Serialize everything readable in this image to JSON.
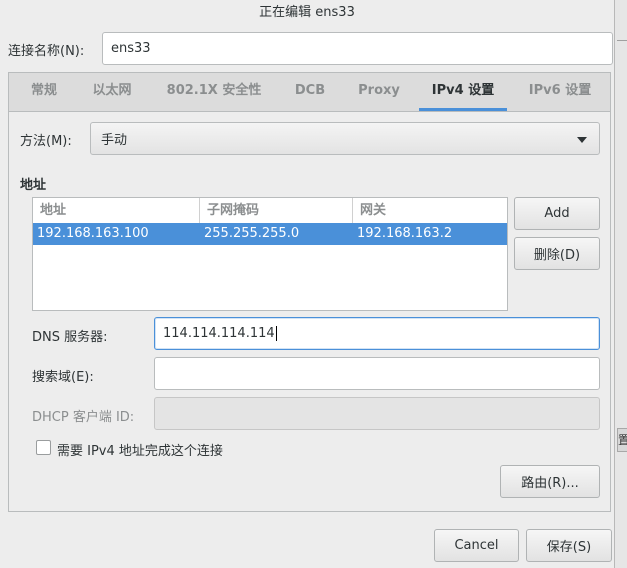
{
  "window": {
    "title": "正在编辑 ens33"
  },
  "connection": {
    "label": "连接名称(N):",
    "value": "ens33"
  },
  "tabs": [
    {
      "label": "常规",
      "active": false
    },
    {
      "label": "以太网",
      "active": false
    },
    {
      "label": "802.1X 安全性",
      "active": false
    },
    {
      "label": "DCB",
      "active": false
    },
    {
      "label": "Proxy",
      "active": false
    },
    {
      "label": "IPv4 设置",
      "active": true
    },
    {
      "label": "IPv6 设置",
      "active": false
    }
  ],
  "method": {
    "label": "方法(M):",
    "value": "手动",
    "icon": "chevron-down-icon"
  },
  "addresses": {
    "section_title": "地址",
    "columns": [
      "地址",
      "子网掩码",
      "网关"
    ],
    "rows": [
      {
        "address": "192.168.163.100",
        "netmask": "255.255.255.0",
        "gateway": "192.168.163.2",
        "selected": true
      }
    ],
    "add_label": "Add",
    "delete_label": "删除(D)"
  },
  "dns": {
    "label": "DNS 服务器:",
    "value": "114.114.114.114"
  },
  "search_domains": {
    "label": "搜索域(E):",
    "value": ""
  },
  "dhcp_client_id": {
    "label": "DHCP 客户端 ID:",
    "value": "",
    "disabled": true
  },
  "require_ipv4": {
    "label": "需要 IPv4 地址完成这个连接",
    "checked": false
  },
  "routes_label": "路由(R)...",
  "footer": {
    "cancel_label": "Cancel",
    "save_label": "保存(S)"
  },
  "background": {
    "partial_label": "置"
  },
  "colors": {
    "accent": "#4a90d9",
    "selection_text": "#ffffff",
    "window_bg": "#ededed"
  }
}
